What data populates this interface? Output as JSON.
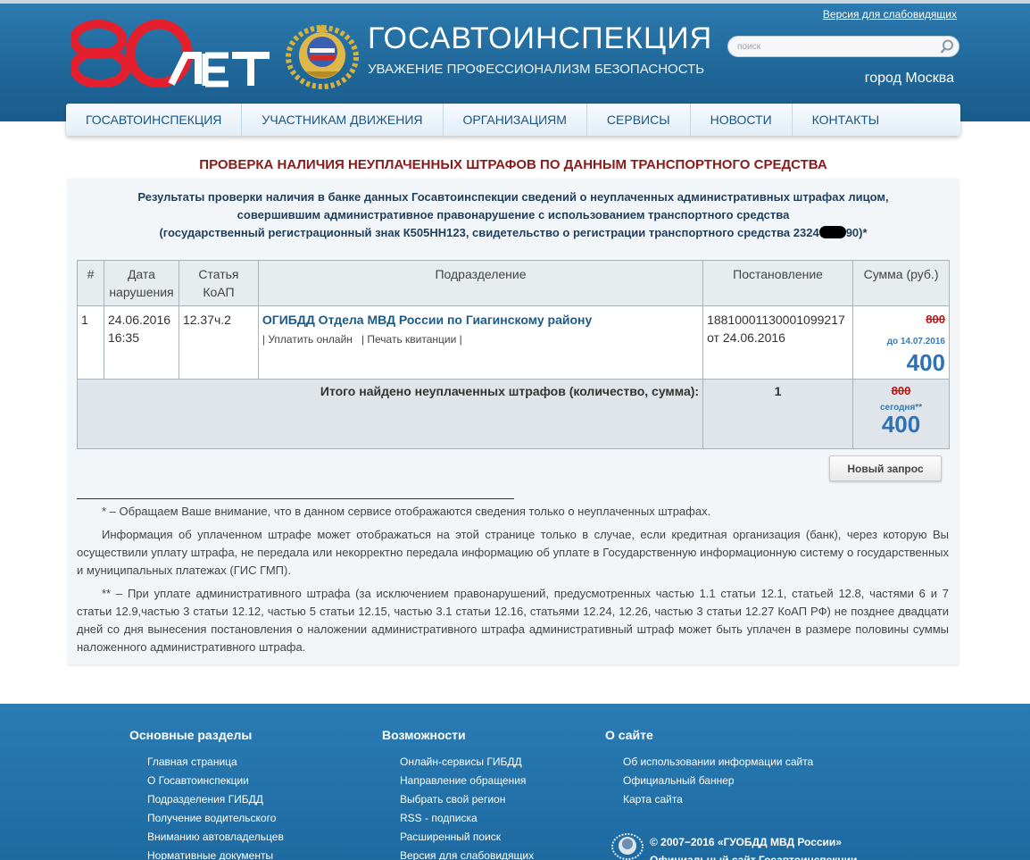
{
  "header": {
    "accessible_link": "Версия для слабовидящих",
    "brand_title": "ГОСАВТОИНСПЕКЦИЯ",
    "brand_subtitle": "УВАЖЕНИЕ ПРОФЕССИОНАЛИЗМ БЕЗОПАСНОСТЬ",
    "logo_text": "80 ЛЕТ",
    "search_placeholder": "поиск",
    "city": "город Москва"
  },
  "nav": {
    "items": [
      "ГОСАВТОИНСПЕКЦИЯ",
      "УЧАСТНИКАМ ДВИЖЕНИЯ",
      "ОРГАНИЗАЦИЯМ",
      "СЕРВИСЫ",
      "НОВОСТИ",
      "КОНТАКТЫ"
    ]
  },
  "main": {
    "title": "ПРОВЕРКА НАЛИЧИЯ НЕУПЛАЧЕННЫХ ШТРАФОВ ПО ДАННЫМ ТРАНСПОРТНОГО СРЕДСТВА",
    "intro_line1": "Результаты проверки наличия в банке данных Госавтоинспекции сведений о неуплаченных административных штрафах лицом,",
    "intro_line2": "совершившим административное правонарушение с использованием транспортного средства",
    "intro_line3_a": "(государственный регистрационный знак К505НН123, свидетельство о регистрации транспортного средства 2324",
    "intro_line3_b": "90)*",
    "table": {
      "headers": [
        "#",
        "Дата нарушения",
        "Статья КоАП",
        "Подразделение",
        "Постановление",
        "Сумма (руб.)"
      ],
      "rows": [
        {
          "num": "1",
          "date": "24.06.2016 16:35",
          "article": "12.37ч.2",
          "division": "ОГИБДД Отдела МВД России по Гиагинскому району",
          "pay_online": "| Уплатить онлайн",
          "print_receipt": "| Печать квитанции |",
          "decision_number": "18810001130001099217",
          "decision_date": "от 24.06.2016",
          "old_sum": "800",
          "until": "до 14.07.2016",
          "new_sum": "400"
        }
      ],
      "total_label": "Итого найдено неуплаченных штрафов (количество, сумма):",
      "total_count": "1",
      "total_old_sum": "800",
      "total_today": "сегодня**",
      "total_new_sum": "400"
    },
    "new_request_button": "Новый запрос",
    "notes": [
      "* – Обращаем Ваше внимание, что в данном сервисе отображаются сведения только о неуплаченных штрафах.",
      "Информация об уплаченном штрафе может отображаться на этой странице только в случае, если кредитная организация (банк), через которую Вы осуществили уплату штрафа, не передала или некорректно передала информацию об уплате в Государственную информационную систему о государственных и муниципальных платежах (ГИС ГМП).",
      "** – При уплате административного штрафа (за исключением правонарушений, предусмотренных частью 1.1 статьи 12.1, статьей 12.8, частями 6 и 7 статьи 12.9,частью 3 статьи 12.12, частью 5 статьи 12.15, частью 3.1 статьи 12.16, статьями 12.24, 12.26, частью 3 статьи 12.27 КоАП РФ) не позднее двадцати дней со дня вынесения постановления о наложении административного штрафа административный штраф может быть уплачен в размере половины суммы наложенного административного штрафа."
    ]
  },
  "footer": {
    "col1": {
      "title": "Основные разделы",
      "items": [
        "Главная страница",
        "О Госавтоинспекции",
        "Подразделения ГИБДД",
        "Получение водительского",
        "Вниманию автовладельцев",
        "Нормативные документы"
      ]
    },
    "col2": {
      "title": "Возможности",
      "items": [
        "Онлайн-сервисы ГИБДД",
        "Направление обращения",
        "Выбрать свой регион",
        "RSS - подписка",
        "Расширенный поиск",
        "Версия для слабовидящих"
      ]
    },
    "col3": {
      "title": "О сайте",
      "items": [
        "Об использовании информации сайта",
        "Официальный баннер",
        "Карта сайта"
      ]
    },
    "copyright_line1": "© 2007−2016 «ГУОБДД МВД России»",
    "copyright_line2": "Официальный сайт Госавтоинспекции"
  },
  "colors": {
    "header_blue": "#1f6698",
    "title_red": "#8b1a1a",
    "link_blue": "#1e5a87",
    "sum_blue": "#2f72b2",
    "strike_red": "#cc1111"
  }
}
